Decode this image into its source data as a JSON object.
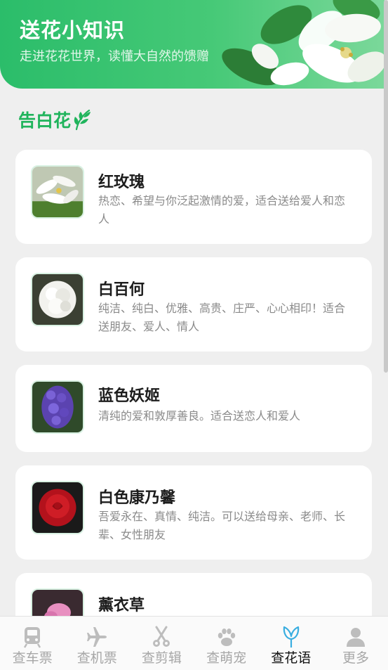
{
  "banner": {
    "title": "送花小知识",
    "subtitle": "走进花花世界，读懂大自然的馈赠",
    "decoration": "white-lily-flower"
  },
  "section": {
    "title": "告白花",
    "icon": "leaf-icon",
    "accent_color": "#20b45c"
  },
  "cards": [
    {
      "title": "红玫瑰",
      "desc": "热恋、希望与你泛起激情的爱，适合送给爱人和恋人",
      "image": "white-lily"
    },
    {
      "title": "白百何",
      "desc": "纯洁、纯白、优雅、高贵、庄严、心心相印！适合送朋友、爱人、情人",
      "image": "white-carnation"
    },
    {
      "title": "蓝色妖姬",
      "desc": "清纯的爱和敦厚善良。适合送恋人和爱人",
      "image": "purple-hyacinth"
    },
    {
      "title": "白色康乃馨",
      "desc": "吾爱永在、真情、纯洁。可以送给母亲、老师、长辈、女性朋友",
      "image": "red-rose"
    },
    {
      "title": "薰衣草",
      "desc": "",
      "image": "pink-sweet-pea"
    }
  ],
  "nav": {
    "items": [
      {
        "label": "查车票",
        "icon": "train-icon",
        "active": false
      },
      {
        "label": "查机票",
        "icon": "airplane-icon",
        "active": false
      },
      {
        "label": "查剪辑",
        "icon": "scissors-icon",
        "active": false
      },
      {
        "label": "查萌宠",
        "icon": "paw-icon",
        "active": false
      },
      {
        "label": "查花语",
        "icon": "flower-icon",
        "active": true
      },
      {
        "label": "更多",
        "icon": "user-icon",
        "active": false
      }
    ],
    "active_color": "#3aaee0",
    "inactive_color": "#bdbdbd"
  }
}
